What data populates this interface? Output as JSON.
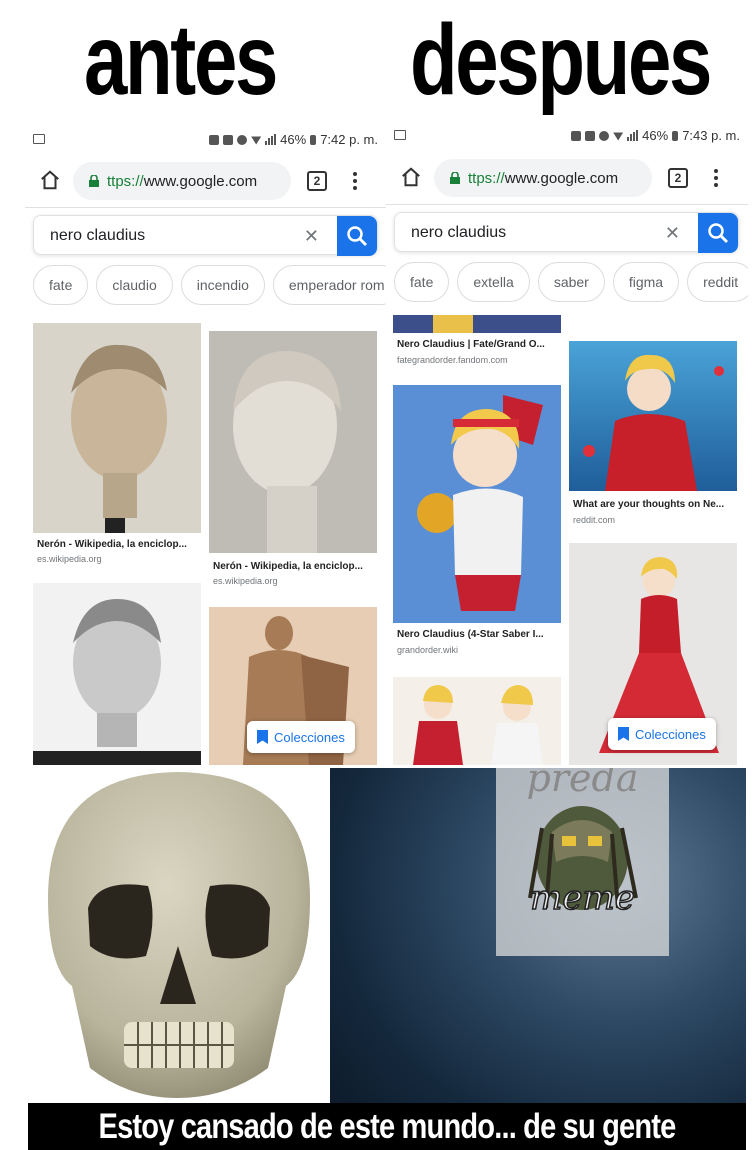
{
  "meme": {
    "title_left": "antes",
    "title_right": "despues",
    "caption": "Estoy cansado de este mundo... de su gente",
    "watermark_top": "preda",
    "watermark_bottom": "meme"
  },
  "colors": {
    "accent_blue": "#1a73e8",
    "url_green": "#188038",
    "chip_border": "#dadce0",
    "caption_bg": "#000000"
  },
  "phones": {
    "left": {
      "status": {
        "battery": "46%",
        "time": "7:42 p. m."
      },
      "url": {
        "scheme": "ttps://",
        "host": "www.google.com"
      },
      "tab_count": "2",
      "search": {
        "query": "nero claudius"
      },
      "chips": [
        "fate",
        "claudio",
        "incendio",
        "emperador rom"
      ],
      "results": [
        {
          "title": "Nerón - Wikipedia, la enciclop...",
          "site": "es.wikipedia.org"
        },
        {
          "title": "Nerón - Wikipedia, la enciclop...",
          "site": "es.wikipedia.org"
        }
      ],
      "collections_label": "Colecciones"
    },
    "right": {
      "status": {
        "battery": "46%",
        "time": "7:43 p. m."
      },
      "url": {
        "scheme": "ttps://",
        "host": "www.google.com"
      },
      "tab_count": "2",
      "search": {
        "query": "nero claudius"
      },
      "chips": [
        "fate",
        "extella",
        "saber",
        "figma",
        "reddit"
      ],
      "results": [
        {
          "title": "Nero Claudius | Fate/Grand O...",
          "site": "fategrandorder.fandom.com"
        },
        {
          "title": "What are your thoughts on Ne...",
          "site": "reddit.com"
        },
        {
          "title": "Nero Claudius (4-Star Saber I...",
          "site": "grandorder.wiki"
        }
      ],
      "collections_label": "Colecciones"
    }
  }
}
